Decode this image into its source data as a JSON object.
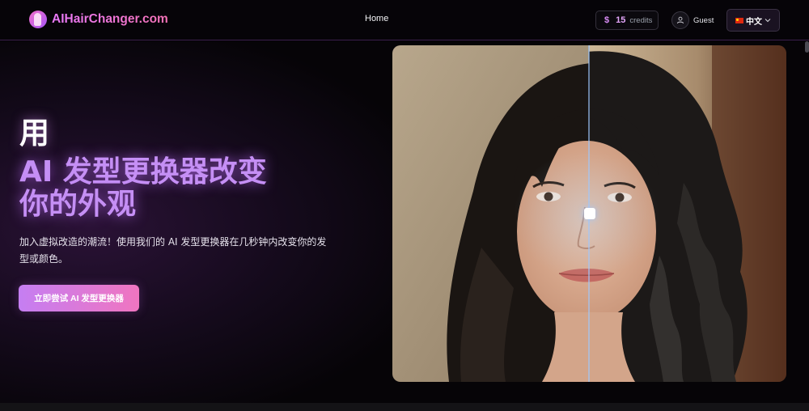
{
  "header": {
    "logo_text": "AIHairChanger.com",
    "nav": {
      "home": "Home"
    },
    "credits": {
      "symbol": "$",
      "count": "15",
      "label": "credits"
    },
    "user": {
      "name": "Guest"
    },
    "language": {
      "label": "中文"
    }
  },
  "hero": {
    "title_line1": "用",
    "title_line2": "AI 发型更换器改变",
    "title_line3": "你的外观",
    "subtitle": "加入虚拟改造的潮流！使用我们的 AI 发型更换器在几秒钟内改变你的发型或颜色。",
    "cta_label": "立即尝试 AI 发型更换器"
  },
  "comparison": {
    "slider_position": 0.5
  },
  "colors": {
    "accent_purple": "#c58ff5",
    "accent_pink": "#f075c0",
    "background": "#050307",
    "header_border": "#3b1f4c"
  },
  "icons": {
    "logo": "hair-silhouette-icon",
    "credits": "dollar-icon",
    "user": "user-icon",
    "language": "china-flag-icon",
    "dropdown": "chevron-down-icon",
    "slider": "slider-handle-icon"
  }
}
